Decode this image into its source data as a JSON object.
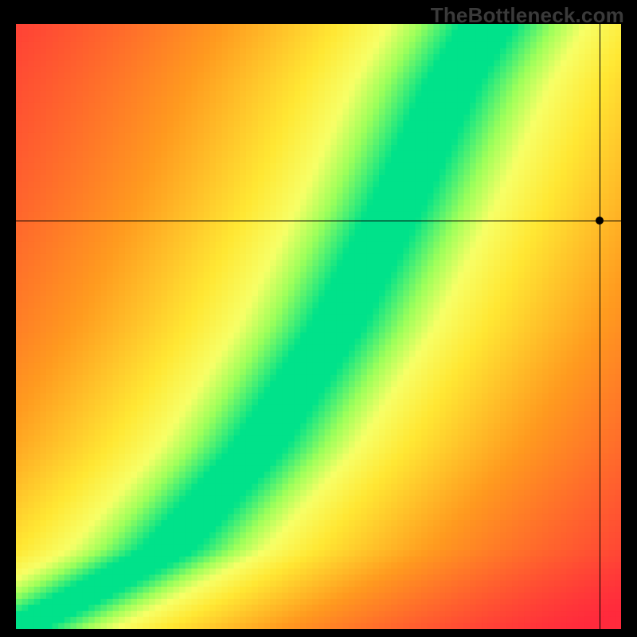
{
  "watermark": "TheBottleneck.com",
  "chart_data": {
    "type": "heatmap",
    "title": "",
    "xlabel": "",
    "ylabel": "",
    "xlim": [
      0,
      1
    ],
    "ylim": [
      0,
      1
    ],
    "grid": false,
    "legend": false,
    "grid_resolution": 100,
    "crosshair": {
      "x": 0.965,
      "y": 0.675
    },
    "marker": {
      "x": 0.965,
      "y": 0.675
    },
    "curve": {
      "description": "Green optimal band along a monotone curve from bottom-left to upper-middle; value is proximity to the curve (1 on curve, 0 far away).",
      "control_points_xy": [
        [
          0.0,
          0.0
        ],
        [
          0.1,
          0.05
        ],
        [
          0.25,
          0.13
        ],
        [
          0.4,
          0.3
        ],
        [
          0.53,
          0.5
        ],
        [
          0.63,
          0.7
        ],
        [
          0.72,
          0.9
        ],
        [
          0.78,
          1.0
        ]
      ],
      "band_halfwidth_x": 0.045
    },
    "color_stops": [
      {
        "t": 0.0,
        "color": "#ff2a3c"
      },
      {
        "t": 0.45,
        "color": "#ff9a1f"
      },
      {
        "t": 0.7,
        "color": "#ffe733"
      },
      {
        "t": 0.82,
        "color": "#f7ff66"
      },
      {
        "t": 0.9,
        "color": "#9dff5a"
      },
      {
        "t": 1.0,
        "color": "#00e28a"
      }
    ]
  }
}
